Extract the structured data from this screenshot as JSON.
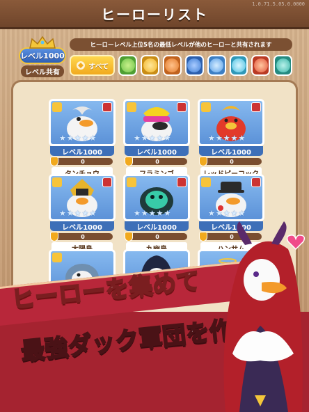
{
  "header": {
    "title": "ヒーローリスト",
    "version": "1.0.71.5.05.0.0000"
  },
  "level_badge": {
    "level_label": "レベル1000",
    "shared_label": "レベル共有"
  },
  "notice": "ヒーローレベル上位5名の最低レベルが他のヒーローと共有されます",
  "filters": {
    "all_label": "すべて",
    "types": [
      {
        "icon": "leaf-icon",
        "color": "#6fc34a"
      },
      {
        "icon": "sun-icon",
        "color": "#f2b52a"
      },
      {
        "icon": "fist-icon",
        "color": "#e27a2b"
      },
      {
        "icon": "shield-icon",
        "color": "#3f7fd6"
      },
      {
        "icon": "sun-face-icon",
        "color": "#5aa0e8"
      },
      {
        "icon": "snowflake-icon",
        "color": "#4ac0e0"
      },
      {
        "icon": "flame-icon",
        "color": "#e2543a"
      },
      {
        "icon": "drop-icon",
        "color": "#39b5a8"
      }
    ]
  },
  "heroes": [
    {
      "name": "タンチョウ",
      "level": "レベル1000",
      "bar_value": "0",
      "stars": 5
    },
    {
      "name": "フラミンゴ",
      "level": "レベル1000",
      "bar_value": "0",
      "stars": 5
    },
    {
      "name": "レッドピーコック",
      "level": "レベル1000",
      "bar_value": "0",
      "stars": 5
    },
    {
      "name": "太陽鳥",
      "level": "レベル1000",
      "bar_value": "0",
      "stars": 5
    },
    {
      "name": "九幽鳥",
      "level": "レベル1000",
      "bar_value": "0",
      "stars": 5
    },
    {
      "name": "ハンサム",
      "level": "レベル1000",
      "bar_value": "0",
      "stars": 5
    },
    {
      "name": "",
      "level": "",
      "bar_value": "",
      "stars": 5
    },
    {
      "name": "",
      "level": "",
      "bar_value": "",
      "stars": 5
    },
    {
      "name": "",
      "level": "",
      "bar_value": "",
      "stars": 5
    }
  ],
  "promo": {
    "line1": "ヒーローを集めて",
    "line2": "最強ダック軍団を作ろう"
  }
}
